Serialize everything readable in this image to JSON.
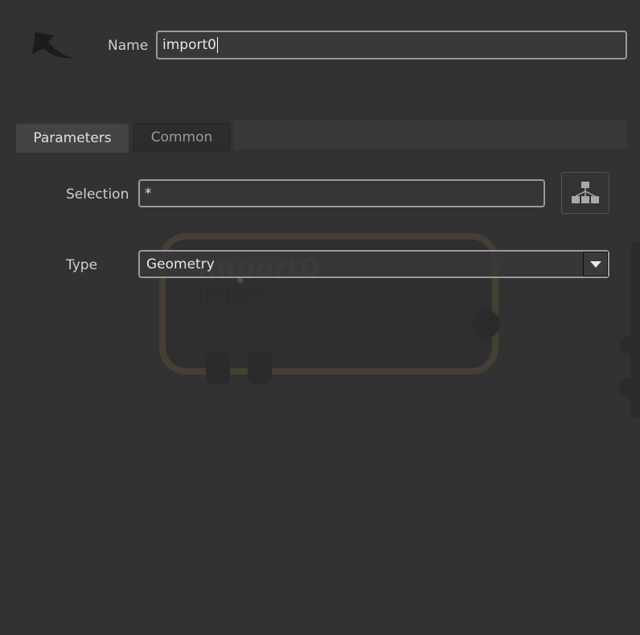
{
  "header": {
    "name_label": "Name",
    "name_value": "import0",
    "node_icon": "curved-arrow-icon"
  },
  "tabs": [
    {
      "label": "Parameters",
      "active": true
    },
    {
      "label": "Common",
      "active": false
    }
  ],
  "params": {
    "selection_label": "Selection",
    "selection_value": "*",
    "selection_button_icon": "hierarchy-icon",
    "type_label": "Type",
    "type_value": "Geometry"
  },
  "watermark": {
    "title": "import0",
    "subtitle": "Import"
  },
  "colors": {
    "background": "#323232",
    "field_border": "#9a9a9a",
    "watermark_outline": "#d9a53a"
  }
}
